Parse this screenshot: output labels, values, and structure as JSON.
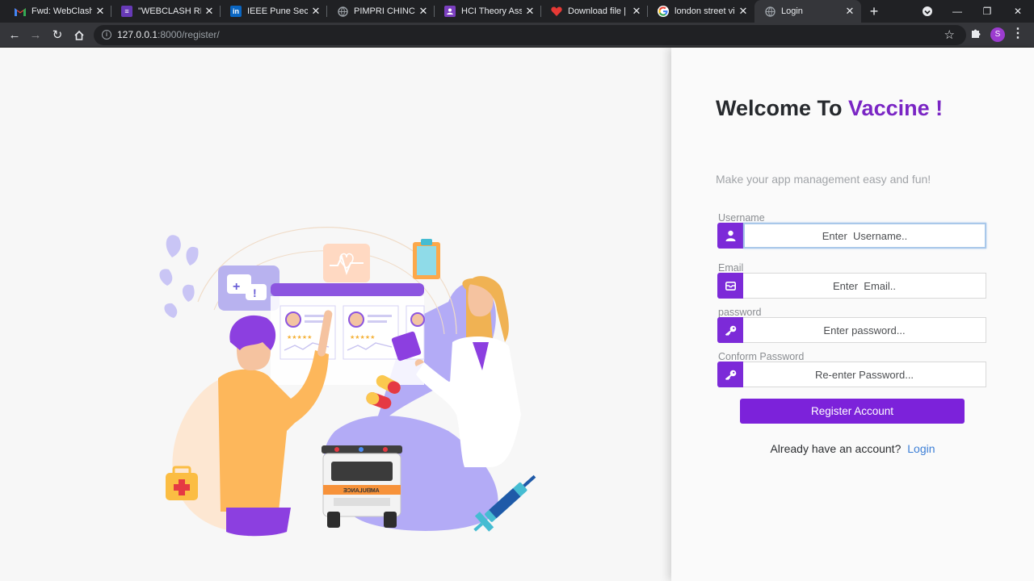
{
  "browser": {
    "tabs": [
      {
        "title": "Fwd: WebClash: Fi",
        "icon": "gmail-icon",
        "color": "#202124"
      },
      {
        "title": "\"WEBCLASH REGI",
        "icon": "forms-icon",
        "color": "#673ab7"
      },
      {
        "title": "IEEE Pune Section",
        "icon": "linkedin-icon",
        "color": "#0a66c2"
      },
      {
        "title": "PIMPRI CHINCHW",
        "icon": "globe-icon",
        "color": "#5f6368"
      },
      {
        "title": "HCI Theory Assign",
        "icon": "classroom-icon",
        "color": "#7b3fbf"
      },
      {
        "title": "Download file | iL",
        "icon": "heart-icon",
        "color": "#e53935"
      },
      {
        "title": "london street view",
        "icon": "google-icon",
        "color": "#ffffff"
      },
      {
        "title": "Login",
        "icon": "globe-icon",
        "color": "#5f6368"
      }
    ],
    "url_host": "127.0.0.1",
    "url_rest": ":8000/register/",
    "avatar_letter": "S"
  },
  "panel": {
    "welcome_prefix": "Welcome To ",
    "brand": "Vaccine !",
    "tagline": "Make your app management easy and fun!",
    "fields": [
      {
        "label": "Username",
        "placeholder": "Enter  Username..",
        "icon": "user-icon"
      },
      {
        "label": "Email",
        "placeholder": "Enter  Email..",
        "icon": "envelope-icon"
      },
      {
        "label": "password",
        "placeholder": "Enter password...",
        "icon": "key-icon"
      },
      {
        "label": "Conform Password",
        "placeholder": "Re-enter Password...",
        "icon": "key-icon"
      }
    ],
    "register_label": "Register Account",
    "signin_text": "Already have an account?",
    "login_link": "Login"
  },
  "colors": {
    "accent": "#7c22da",
    "brand_text": "#7a25c4",
    "link": "#3b7ed6"
  }
}
